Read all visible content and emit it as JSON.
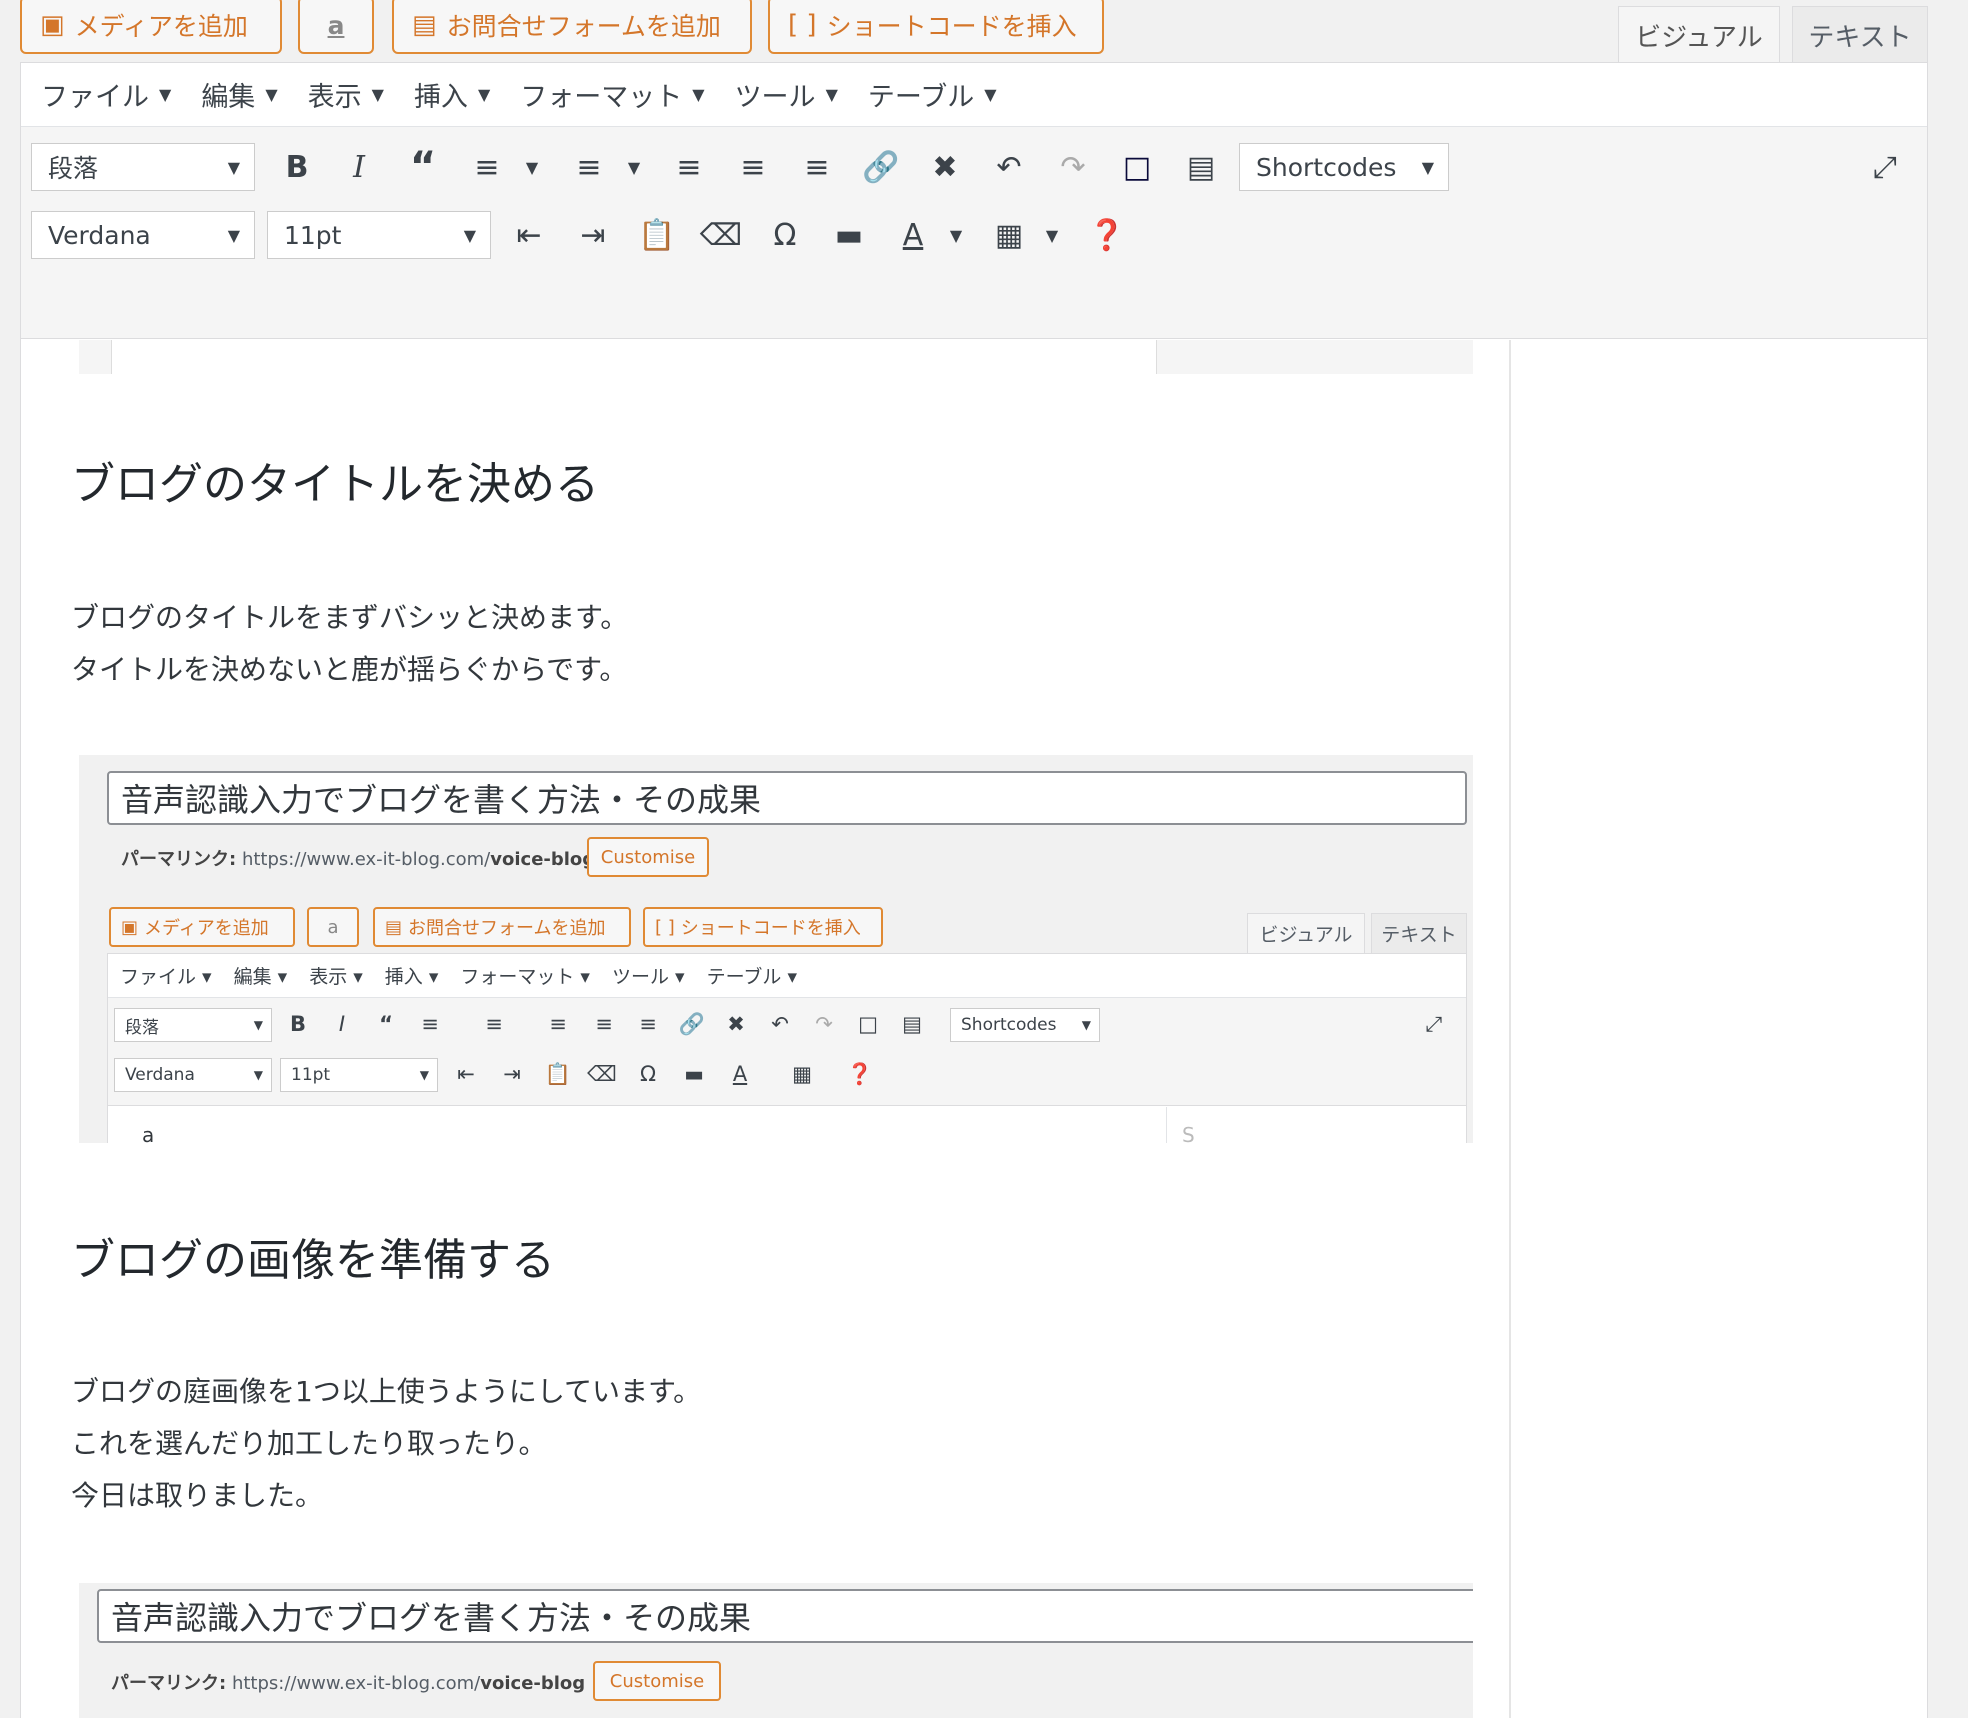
{
  "media_buttons": {
    "add_media": "メディアを追加",
    "amazon": "a",
    "add_contact_form": "お問合せフォームを追加",
    "insert_shortcode": "ショートコードを挿入"
  },
  "editor_tabs": {
    "visual": "ビジュアル",
    "text": "テキスト"
  },
  "menubar": [
    "ファイル",
    "編集",
    "表示",
    "挿入",
    "フォーマット",
    "ツール",
    "テーブル"
  ],
  "toolbar": {
    "format_select": "段落",
    "font_family_select": "Verdana",
    "font_size_select": "11pt",
    "shortcodes_select": "Shortcodes"
  },
  "content": {
    "heading1": "ブログのタイトルを決める",
    "para1": [
      "ブログのタイトルをまずバシッと決めます。",
      "タイトルを決めないと鹿が揺らぐからです。"
    ],
    "heading2": "ブログの画像を準備する",
    "para2": [
      "ブログの庭画像を1つ以上使うようにしています。",
      "これを選んだり加工したり取ったり。",
      "今日は取りました。"
    ]
  },
  "embedded_screenshot": {
    "post_title": "音声認識入力でブログを書く方法・その成果",
    "permalink_label": "パーマリンク:",
    "permalink_base": "https://www.ex-it-blog.com/",
    "permalink_slug": "voice-blog",
    "customise": "Customise",
    "body_char": "a",
    "side_char": "S"
  }
}
